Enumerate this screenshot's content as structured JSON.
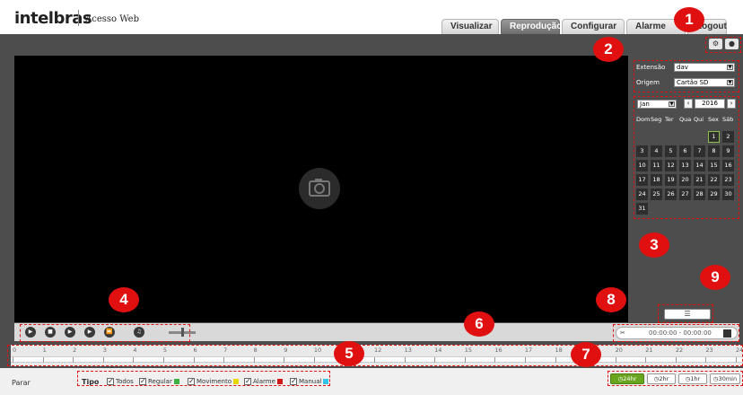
{
  "header": {
    "logo": "intelbras",
    "subtitle": "Acesso Web",
    "tabs": [
      "Visualizar",
      "Reprodução",
      "Configurar",
      "Alarme",
      "Logout"
    ],
    "active_tab": "Reprodução"
  },
  "source": {
    "extension_label": "Extensão",
    "extension_value": "dav",
    "origin_label": "Origem",
    "origin_value": "Cartão SD"
  },
  "calendar": {
    "month": "Jan",
    "year": "2016",
    "weekdays": [
      "Dom",
      "Seg",
      "Ter",
      "Qua",
      "Qui",
      "Sex",
      "Sáb"
    ],
    "days": [
      "1",
      "2",
      "3",
      "4",
      "5",
      "6",
      "7",
      "8",
      "9",
      "10",
      "11",
      "12",
      "13",
      "14",
      "15",
      "16",
      "17",
      "18",
      "19",
      "20",
      "21",
      "22",
      "23",
      "24",
      "25",
      "26",
      "27",
      "28",
      "29",
      "30",
      "31"
    ],
    "highlighted_day": "1"
  },
  "playback": {
    "time_range": "00:00:00 - 00:00:00"
  },
  "timeline": {
    "hours": [
      "0",
      "1",
      "2",
      "3",
      "4",
      "5",
      "6",
      "7",
      "8",
      "9",
      "10",
      "11",
      "12",
      "13",
      "14",
      "15",
      "16",
      "17",
      "18",
      "19",
      "20",
      "21",
      "22",
      "23",
      "24"
    ]
  },
  "bottom": {
    "status": "Parar",
    "tipo_label": "Tipo",
    "filters": [
      {
        "label": "Todos",
        "color": ""
      },
      {
        "label": "Regular",
        "color": "#3cb043"
      },
      {
        "label": "Movimento",
        "color": "#e6d800"
      },
      {
        "label": "Alarme",
        "color": "#d11a1a"
      },
      {
        "label": "Manual",
        "color": "#35c3e6"
      }
    ],
    "zoom": [
      "24hr",
      "2hr",
      "1hr",
      "30min"
    ],
    "zoom_active": "24hr"
  },
  "callouts": [
    "1",
    "2",
    "3",
    "4",
    "5",
    "6",
    "7",
    "8",
    "9"
  ],
  "colors": {
    "accent": "#e01010",
    "record": "#8bc34a",
    "active_zoom": "#6aa520"
  }
}
